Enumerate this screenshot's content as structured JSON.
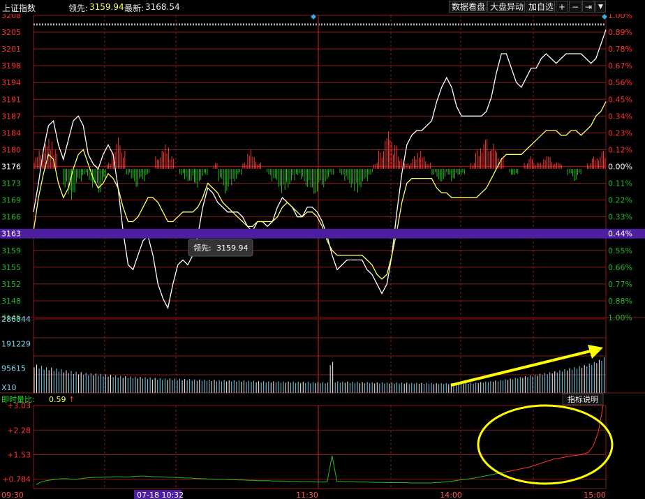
{
  "header": {
    "index_name": "上证指数",
    "lead_label": "领先:",
    "lead_value": "3159.94",
    "last_label": "最新:",
    "last_value": "3168.54",
    "buttons": [
      "数据看盘",
      "大盘异动",
      "加自选"
    ],
    "icons": [
      "plus-icon",
      "minus-icon",
      "collapse-icon",
      "dropdown-icon"
    ]
  },
  "colors": {
    "background": "#000000",
    "grid": "#8b1a1a",
    "up": "#ff3333",
    "down": "#22bb22",
    "price_line": "#ffffff",
    "lead_line": "#ffff66",
    "volume": "#7fd3f0",
    "highlight": "#4b1fa0",
    "annotation": "#ffff00"
  },
  "tooltip": {
    "label": "领先:",
    "value": "3159.94"
  },
  "indicator": {
    "label": "即时量比:",
    "value": "0.59",
    "help_button": "指标说明",
    "ticks": [
      "+3.03",
      "+2.28",
      "+1.53",
      "+0.784"
    ]
  },
  "volume_axis": {
    "ticks": [
      "286844",
      "191229",
      "95615"
    ],
    "unit": "X10"
  },
  "chart_data": [
    {
      "type": "line",
      "name": "price",
      "ylim": [
        3145,
        3208
      ],
      "y_ticks_left": [
        "3208",
        "3205",
        "3201",
        "3198",
        "3194",
        "3191",
        "3187",
        "3184",
        "3180",
        "3176",
        "3173",
        "3169",
        "3166",
        "3163",
        "3159",
        "3155",
        "3152",
        "3148",
        "3145"
      ],
      "y_ticks_right": [
        "1.00%",
        "0.89%",
        "0.78%",
        "0.67%",
        "0.56%",
        "0.45%",
        "0.34%",
        "0.23%",
        "0.12%",
        "0.00%",
        "0.11%",
        "0.22%",
        "0.33%",
        "0.44%",
        "0.55%",
        "0.66%",
        "0.77%",
        "0.88%",
        "1.00%"
      ],
      "highlight_tick": "3163",
      "x_ticks": [
        "09:30",
        "07-18 10:32",
        "11:30",
        "14:00",
        "15:00"
      ],
      "baseline": 3176,
      "series": [
        {
          "values": [
            3167,
            3173,
            3180,
            3185,
            3186,
            3181,
            3178,
            3182,
            3186,
            3187,
            3185,
            3179,
            3177,
            3176,
            3179,
            3181,
            3179,
            3172,
            3163,
            3156,
            3155,
            3158,
            3161,
            3162,
            3158,
            3152,
            3149,
            3147,
            3152,
            3156,
            3157,
            3156,
            3158,
            3162,
            3168,
            3172,
            3171,
            3169,
            3168,
            3167,
            3167,
            3167,
            3166,
            3164,
            3163,
            3165,
            3165,
            3164,
            3165,
            3168,
            3170,
            3169,
            3168,
            3166,
            3166,
            3168,
            3168,
            3167,
            3165,
            3162,
            3158,
            3155,
            3156,
            3157,
            3157,
            3157,
            3157,
            3155,
            3154,
            3152,
            3150,
            3152,
            3158,
            3167,
            3175,
            3181,
            3183,
            3184,
            3184,
            3185,
            3186,
            3190,
            3193,
            3195,
            3193,
            3189,
            3187,
            3187,
            3187,
            3187,
            3187,
            3188,
            3191,
            3196,
            3200,
            3200,
            3197,
            3194,
            3193,
            3195,
            3197,
            3197,
            3199,
            3200,
            3199,
            3198,
            3199,
            3200,
            3200,
            3200,
            3200,
            3199,
            3198,
            3199,
            3202,
            3205
          ]
        },
        {
          "values": [
            3163,
            3170,
            3175,
            3179,
            3178,
            3173,
            3170,
            3172,
            3176,
            3179,
            3180,
            3177,
            3174,
            3172,
            3173,
            3175,
            3174,
            3172,
            3168,
            3165,
            3165,
            3166,
            3168,
            3170,
            3170,
            3169,
            3167,
            3165,
            3165,
            3166,
            3167,
            3167,
            3167,
            3168,
            3170,
            3173,
            3172,
            3171,
            3169,
            3168,
            3167,
            3166,
            3165,
            3164,
            3164,
            3165,
            3165,
            3165,
            3165,
            3166,
            3168,
            3169,
            3168,
            3167,
            3166,
            3167,
            3167,
            3166,
            3164,
            3161,
            3159,
            3158,
            3158,
            3158,
            3158,
            3158,
            3158,
            3157,
            3156,
            3154,
            3153,
            3154,
            3158,
            3163,
            3169,
            3173,
            3174,
            3174,
            3174,
            3174,
            3174,
            3172,
            3171,
            3171,
            3170,
            3170,
            3170,
            3170,
            3170,
            3170,
            3171,
            3172,
            3174,
            3176,
            3178,
            3179,
            3179,
            3179,
            3179,
            3180,
            3181,
            3182,
            3183,
            3184,
            3184,
            3184,
            3183,
            3183,
            3184,
            3184,
            3183,
            3184,
            3185,
            3187,
            3188,
            3190
          ]
        }
      ],
      "bars": [
        2,
        3,
        4,
        5,
        3,
        0,
        -3,
        -5,
        -4,
        -2,
        -1,
        -2,
        -3,
        -4,
        -2,
        1,
        3,
        5,
        3,
        -1,
        -2,
        -3,
        -2,
        -1,
        0,
        2,
        3,
        4,
        2,
        0,
        -1,
        -2,
        -2,
        -3,
        -2,
        -1,
        0,
        1,
        -2,
        -4,
        -3,
        -2,
        -1,
        1,
        3,
        2,
        1,
        0,
        -1,
        -2,
        -3,
        -4,
        -3,
        -2,
        -1,
        -2,
        -3,
        -4,
        -4,
        -3,
        -2,
        -1,
        0,
        -1,
        -2,
        -3,
        -4,
        -3,
        -2,
        -1,
        1,
        3,
        5,
        6,
        4,
        2,
        1,
        1,
        2,
        3,
        2,
        1,
        -1,
        -2,
        -2,
        -1,
        -2,
        -1,
        -1,
        0,
        1,
        3,
        4,
        5,
        4,
        3,
        2,
        0,
        -1,
        -1,
        0,
        1,
        2,
        1,
        1,
        2,
        2,
        1,
        1,
        0,
        -1,
        -2,
        -1,
        0,
        1,
        2,
        2,
        3
      ]
    },
    {
      "type": "bar",
      "name": "volume",
      "ylim": [
        0,
        286844
      ],
      "y_ticks": [
        286844,
        191229,
        95615
      ],
      "values": [
        110,
        105,
        100,
        98,
        95,
        92,
        88,
        85,
        82,
        80,
        78,
        76,
        75,
        74,
        72,
        70,
        68,
        66,
        65,
        64,
        63,
        62,
        61,
        60,
        58,
        57,
        56,
        56,
        55,
        55,
        54,
        54,
        53,
        52,
        52,
        51,
        51,
        50,
        50,
        49,
        49,
        48,
        48,
        47,
        47,
        46,
        46,
        45,
        45,
        45,
        44,
        44,
        44,
        43,
        43,
        43,
        42,
        42,
        42,
        41,
        120,
        45,
        44,
        44,
        43,
        43,
        42,
        42,
        42,
        41,
        41,
        40,
        40,
        40,
        40,
        40,
        39,
        39,
        39,
        39,
        39,
        38,
        38,
        38,
        38,
        38,
        38,
        38,
        39,
        40,
        42,
        44,
        46,
        48,
        50,
        53,
        56,
        59,
        62,
        65,
        68,
        71,
        74,
        77,
        80,
        84,
        88,
        92,
        96,
        100,
        104,
        108,
        114,
        120,
        128,
        138
      ]
    },
    {
      "type": "line",
      "name": "即时量比",
      "ylim": [
        0.5,
        3.03
      ],
      "y_ticks": [
        3.03,
        2.28,
        1.53,
        0.784
      ],
      "values": [
        0.62,
        0.7,
        0.74,
        0.76,
        0.78,
        0.8,
        0.8,
        0.79,
        0.78,
        0.8,
        0.82,
        0.83,
        0.84,
        0.84,
        0.85,
        0.85,
        0.86,
        0.86,
        0.85,
        0.86,
        0.87,
        0.88,
        0.88,
        0.87,
        0.86,
        0.86,
        0.85,
        0.84,
        0.84,
        0.83,
        0.82,
        0.82,
        0.81,
        0.8,
        0.8,
        0.79,
        0.79,
        0.78,
        0.78,
        0.77,
        0.77,
        0.76,
        0.76,
        0.75,
        0.75,
        0.74,
        0.74,
        0.74,
        0.73,
        0.73,
        0.73,
        0.72,
        0.72,
        0.72,
        0.71,
        0.71,
        0.71,
        0.7,
        0.7,
        0.7,
        1.5,
        0.72,
        0.72,
        0.71,
        0.71,
        0.7,
        0.7,
        0.7,
        0.69,
        0.69,
        0.69,
        0.68,
        0.68,
        0.68,
        0.68,
        0.68,
        0.67,
        0.67,
        0.67,
        0.67,
        0.67,
        0.68,
        0.69,
        0.7,
        0.72,
        0.74,
        0.76,
        0.78,
        0.8,
        0.82,
        0.85,
        0.88,
        0.91,
        0.94,
        0.97,
        1.0,
        1.03,
        1.06,
        1.09,
        1.12,
        1.15,
        1.2,
        1.25,
        1.3,
        1.35,
        1.4,
        1.42,
        1.45,
        1.48,
        1.5,
        1.52,
        1.55,
        1.6,
        1.8,
        2.2,
        3.03
      ]
    }
  ]
}
